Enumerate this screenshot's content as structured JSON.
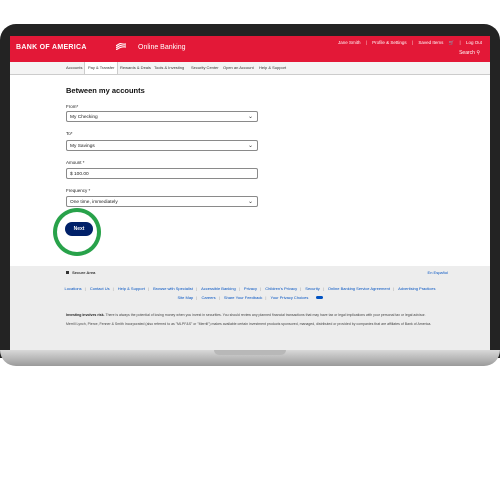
{
  "header": {
    "brand": "BANK OF AMERICA",
    "app_title": "Online Banking",
    "user": "Jane Smith",
    "profile": "Profile & Settings",
    "saved_items": "Saved Items",
    "logout": "Log Out",
    "search": "Search"
  },
  "nav": {
    "items": [
      "Accounts",
      "Pay & Transfer",
      "Rewards & Deals",
      "Tools & Investing",
      "Security Center",
      "Open an Account",
      "Help & Support"
    ]
  },
  "form": {
    "heading": "Between my accounts",
    "from_label": "From*",
    "from_value": "My Checking",
    "to_label": "To*",
    "to_value": "My Savings",
    "amount_label": "Amount *",
    "amount_value": "$ 100.00",
    "frequency_label": "Frequency *",
    "frequency_value": "One time, immediately",
    "next_label": "Next"
  },
  "footer": {
    "secure": "Secure Area",
    "language": "En Español",
    "links_row1": [
      "Locations",
      "Contact Us",
      "Help & Support",
      "Browse with Specialist",
      "Accessible Banking",
      "Privacy",
      "Children's Privacy",
      "Security",
      "Online Banking Service Agreement",
      "Advertising Practices"
    ],
    "links_row2": [
      "Site Map",
      "Careers",
      "Share Your Feedback",
      "Your Privacy Choices"
    ],
    "disclaimer_bold": "Investing involves risk.",
    "disclaimer1": "There is always the potential of losing money when you invest in securities. You should review any planned financial transactions that may have tax or legal implications with your personal tax or legal advisor.",
    "disclaimer2": "Merrill Lynch, Pierce, Fenner & Smith Incorporated (also referred to as \"MLPF&S\" or \"Merrill\") makes available certain investment products sponsored, managed, distributed or provided by companies that are affiliates of Bank of America."
  },
  "colors": {
    "brand_red": "#e31837",
    "button_navy": "#012169",
    "highlight_green": "#28a24a"
  }
}
